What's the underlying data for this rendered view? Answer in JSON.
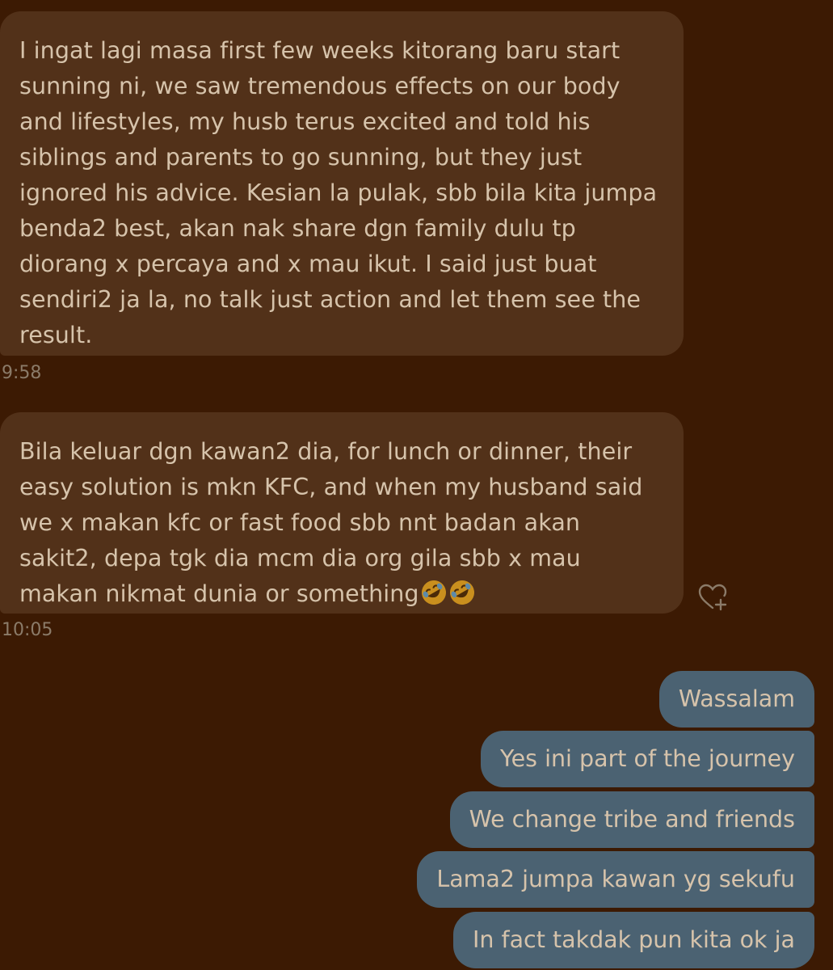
{
  "messages": {
    "received": [
      {
        "text": "I ingat lagi masa first few weeks kitorang baru start sunning ni, we saw tremendous effects on our body and lifestyles, my husb terus excited and told his siblings and parents to go sunning, but they just ignored his advice. Kesian la pulak, sbb bila kita jumpa benda2 best, akan nak share dgn family dulu tp diorang x percaya and x mau ikut. I said just buat sendiri2 ja la, no talk just action and let them see the result.",
        "time": "9:58"
      },
      {
        "text": "Bila keluar dgn kawan2 dia, for lunch or dinner, their easy solution is mkn KFC, and when my husband said we x makan kfc or fast food sbb nnt badan akan sakit2, depa tgk dia mcm dia org gila sbb x mau makan nikmat dunia or something",
        "emoji": "rolling-on-floor-laughing-emoji",
        "time": "10:05"
      }
    ],
    "sent": [
      {
        "text": "Wassalam"
      },
      {
        "text": "Yes ini part of the journey"
      },
      {
        "text": "We change tribe and friends"
      },
      {
        "text": "Lama2 jumpa kawan yg sekufu"
      },
      {
        "text": "In fact takdak pun kita ok ja"
      }
    ]
  },
  "icons": {
    "react": "heart-plus-icon"
  },
  "colors": {
    "background": "#3c1a03",
    "received_bubble": "#523119",
    "sent_bubble": "#4b6272",
    "text": "#d6c3ab",
    "timestamp": "#8b7b69"
  }
}
